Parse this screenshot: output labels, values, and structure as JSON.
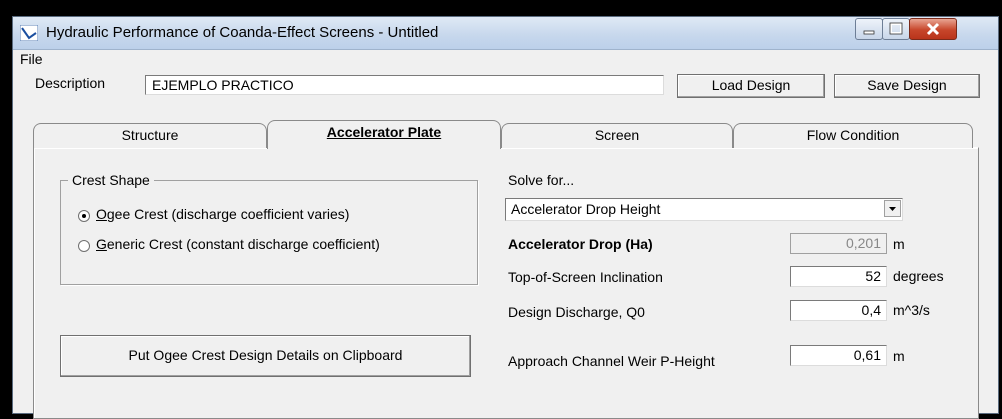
{
  "window": {
    "title": "Hydraulic Performance of Coanda-Effect Screens - Untitled"
  },
  "menu": {
    "file": "File"
  },
  "description": {
    "label": "Description",
    "value": "EJEMPLO PRACTICO"
  },
  "buttons": {
    "load": "Load Design",
    "save": "Save Design",
    "clipboard": "Put Ogee Crest Design Details on Clipboard"
  },
  "tabs": [
    {
      "label": "Structure",
      "active": false
    },
    {
      "label": "Accelerator Plate",
      "active": true
    },
    {
      "label": "Screen",
      "active": false
    },
    {
      "label": "Flow Condition",
      "active": false
    }
  ],
  "crest": {
    "title": "Crest Shape",
    "options": [
      {
        "key": "O",
        "rest": "gee Crest (discharge coefficient varies)",
        "selected": true
      },
      {
        "key": "G",
        "rest": "eneric Crest (constant discharge coefficient)",
        "selected": false
      }
    ]
  },
  "solve": {
    "label": "Solve for...",
    "selected": "Accelerator Drop Height"
  },
  "params": [
    {
      "label": "Accelerator Drop (Ha)",
      "value": "0,201",
      "unit": "m"
    },
    {
      "label": "Top-of-Screen Inclination",
      "value": "52",
      "unit": "degrees"
    },
    {
      "label": "Design Discharge, Q0",
      "value": "0,4",
      "unit": "m^3/s"
    },
    {
      "label": "Approach Channel Weir P-Height",
      "value": "0,61",
      "unit": "m"
    }
  ]
}
